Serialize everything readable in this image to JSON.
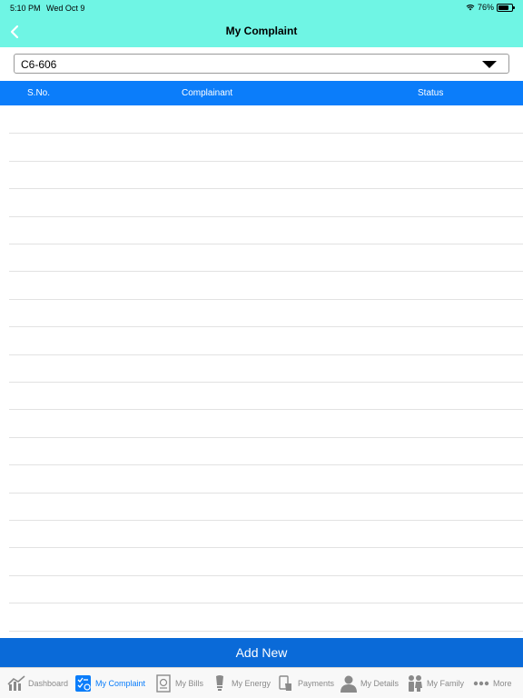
{
  "status_bar": {
    "time": "5:10 PM",
    "date": "Wed Oct 9",
    "battery": "76%",
    "battery_level": 0.76
  },
  "nav": {
    "title": "My Complaint"
  },
  "selector": {
    "value": "C6-606"
  },
  "table": {
    "columns": [
      "S.No.",
      "Complainant",
      "Status"
    ],
    "empty_row_count": 19
  },
  "add_new_label": "Add New",
  "colors": {
    "header_bg": "#6ff5e4",
    "table_header_bg": "#0b7dfa",
    "add_button_bg": "#0a6ad8",
    "tab_active": "#0b7dfa",
    "tab_inactive": "#8a8a8a"
  },
  "tabs": [
    {
      "label": "Dashboard",
      "icon": "chart-icon",
      "active": false
    },
    {
      "label": "My Complaint",
      "icon": "complaint-icon",
      "active": true
    },
    {
      "label": "My Bills",
      "icon": "bill-icon",
      "active": false
    },
    {
      "label": "My Energy",
      "icon": "bulb-icon",
      "active": false
    },
    {
      "label": "Payments",
      "icon": "payment-icon",
      "active": false
    },
    {
      "label": "My Details",
      "icon": "person-icon",
      "active": false
    },
    {
      "label": "My Family",
      "icon": "family-icon",
      "active": false
    },
    {
      "label": "More",
      "icon": "more-icon",
      "active": false
    }
  ]
}
